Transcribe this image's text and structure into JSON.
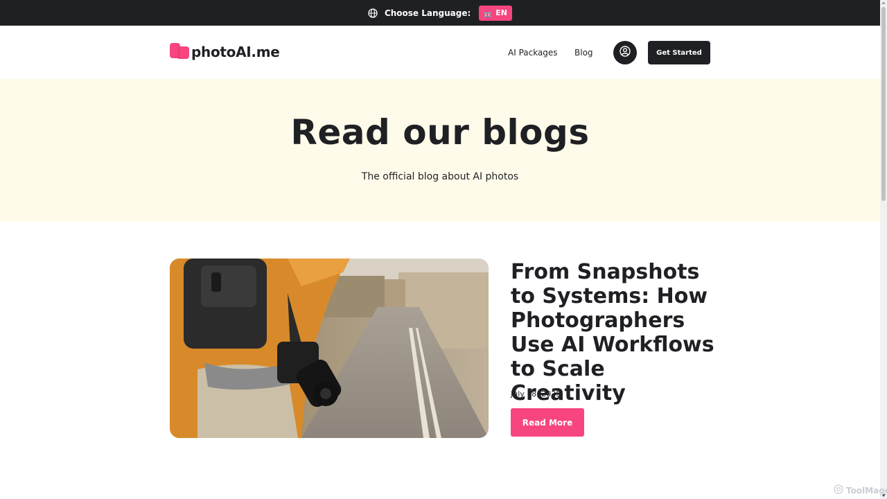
{
  "topbar": {
    "language_label": "Choose Language:",
    "language_code": "EN",
    "globe_icon": "globe-icon",
    "flag_icon": "uk-flag-icon"
  },
  "header": {
    "logo_text": "photoAI.me",
    "nav": [
      {
        "label": "AI Packages"
      },
      {
        "label": "Blog"
      }
    ],
    "user_icon": "user-circle-icon",
    "cta_label": "Get Started"
  },
  "hero": {
    "title": "Read our blogs",
    "subtitle": "The official blog about AI photos"
  },
  "post": {
    "image": "photographer-backpack-camera-street",
    "title": "From Snapshots to Systems: How Photographers Use AI Workflows to Scale Creativity",
    "date": "July 18, 2025",
    "read_more": "Read More"
  },
  "watermark": {
    "text": "ToolMage"
  },
  "colors": {
    "dark": "#1f2024",
    "accent": "#f7457f",
    "hero_bg": "#fffbea"
  }
}
